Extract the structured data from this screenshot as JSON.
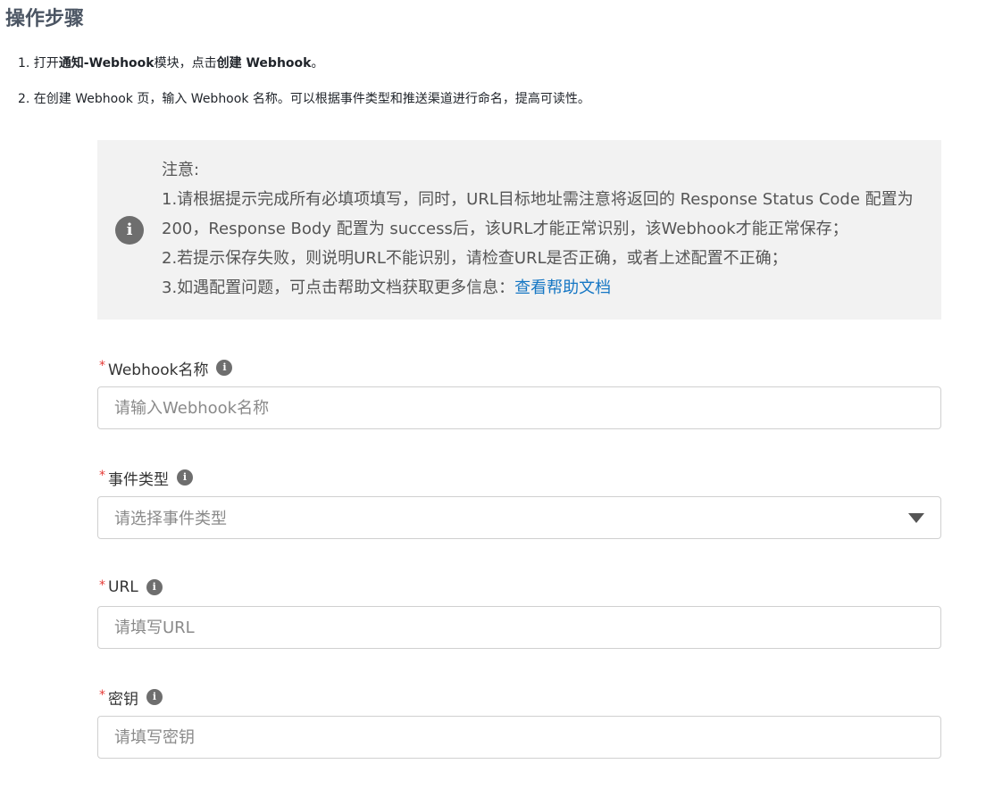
{
  "section": {
    "title": "操作步骤"
  },
  "steps": [
    {
      "prefix": "1. 打开",
      "b1": "通知-Webhook",
      "mid": "模块，点击",
      "b2": "创建 Webhook",
      "suffix": "。"
    },
    {
      "text": "2. 在创建 Webhook 页，输入 Webhook 名称。可以根据事件类型和推送渠道进行命名，提高可读性。"
    }
  ],
  "notice": {
    "icon": "info-icon",
    "title": "注意:",
    "line1": "1.请根据提示完成所有必填项填写，同时，URL目标地址需注意将返回的 Response Status Code 配置为 200，Response Body 配置为 success后，该URL才能正常识别，该Webhook才能正常保存；",
    "line2": "2.若提示保存失败，则说明URL不能识别，请检查URL是否正确，或者上述配置不正确；",
    "line3_prefix": "3.如遇配置问题，可点击帮助文档获取更多信息：",
    "line3_link": "查看帮助文档",
    "link_color": "#1677c4"
  },
  "form": {
    "required_mark": "*",
    "required_color": "#e53935",
    "webhook_name": {
      "label": "Webhook名称",
      "placeholder": "请输入Webhook名称",
      "value": ""
    },
    "event_type": {
      "label": "事件类型",
      "placeholder": "请选择事件类型"
    },
    "url": {
      "label": "URL",
      "placeholder": "请填写URL",
      "value": ""
    },
    "secret": {
      "label": "密钥",
      "placeholder": "请填写密钥",
      "value": ""
    }
  }
}
